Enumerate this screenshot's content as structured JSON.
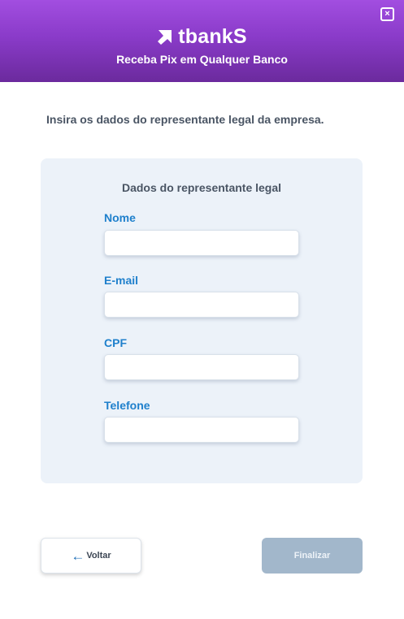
{
  "header": {
    "brand": "tbankS",
    "subtitle": "Receba Pix em Qualquer Banco",
    "close_symbol": "×",
    "gradient": [
      "#a24ee0",
      "#6b2a9d"
    ]
  },
  "instruction": "Insira os dados do representante legal da empresa.",
  "form": {
    "title": "Dados do representante legal",
    "fields": [
      {
        "label": "Nome",
        "value": "",
        "placeholder": ""
      },
      {
        "label": "E-mail",
        "value": "",
        "placeholder": ""
      },
      {
        "label": "CPF",
        "value": "",
        "placeholder": ""
      },
      {
        "label": "Telefone",
        "value": "",
        "placeholder": ""
      }
    ]
  },
  "actions": {
    "back_label": "Voltar",
    "back_icon": "←",
    "finish_label": "Finalizar"
  },
  "colors": {
    "label_blue": "#1f80cc",
    "finish_disabled": "#a2b7cb",
    "card_bg": "#ecf2f9"
  }
}
